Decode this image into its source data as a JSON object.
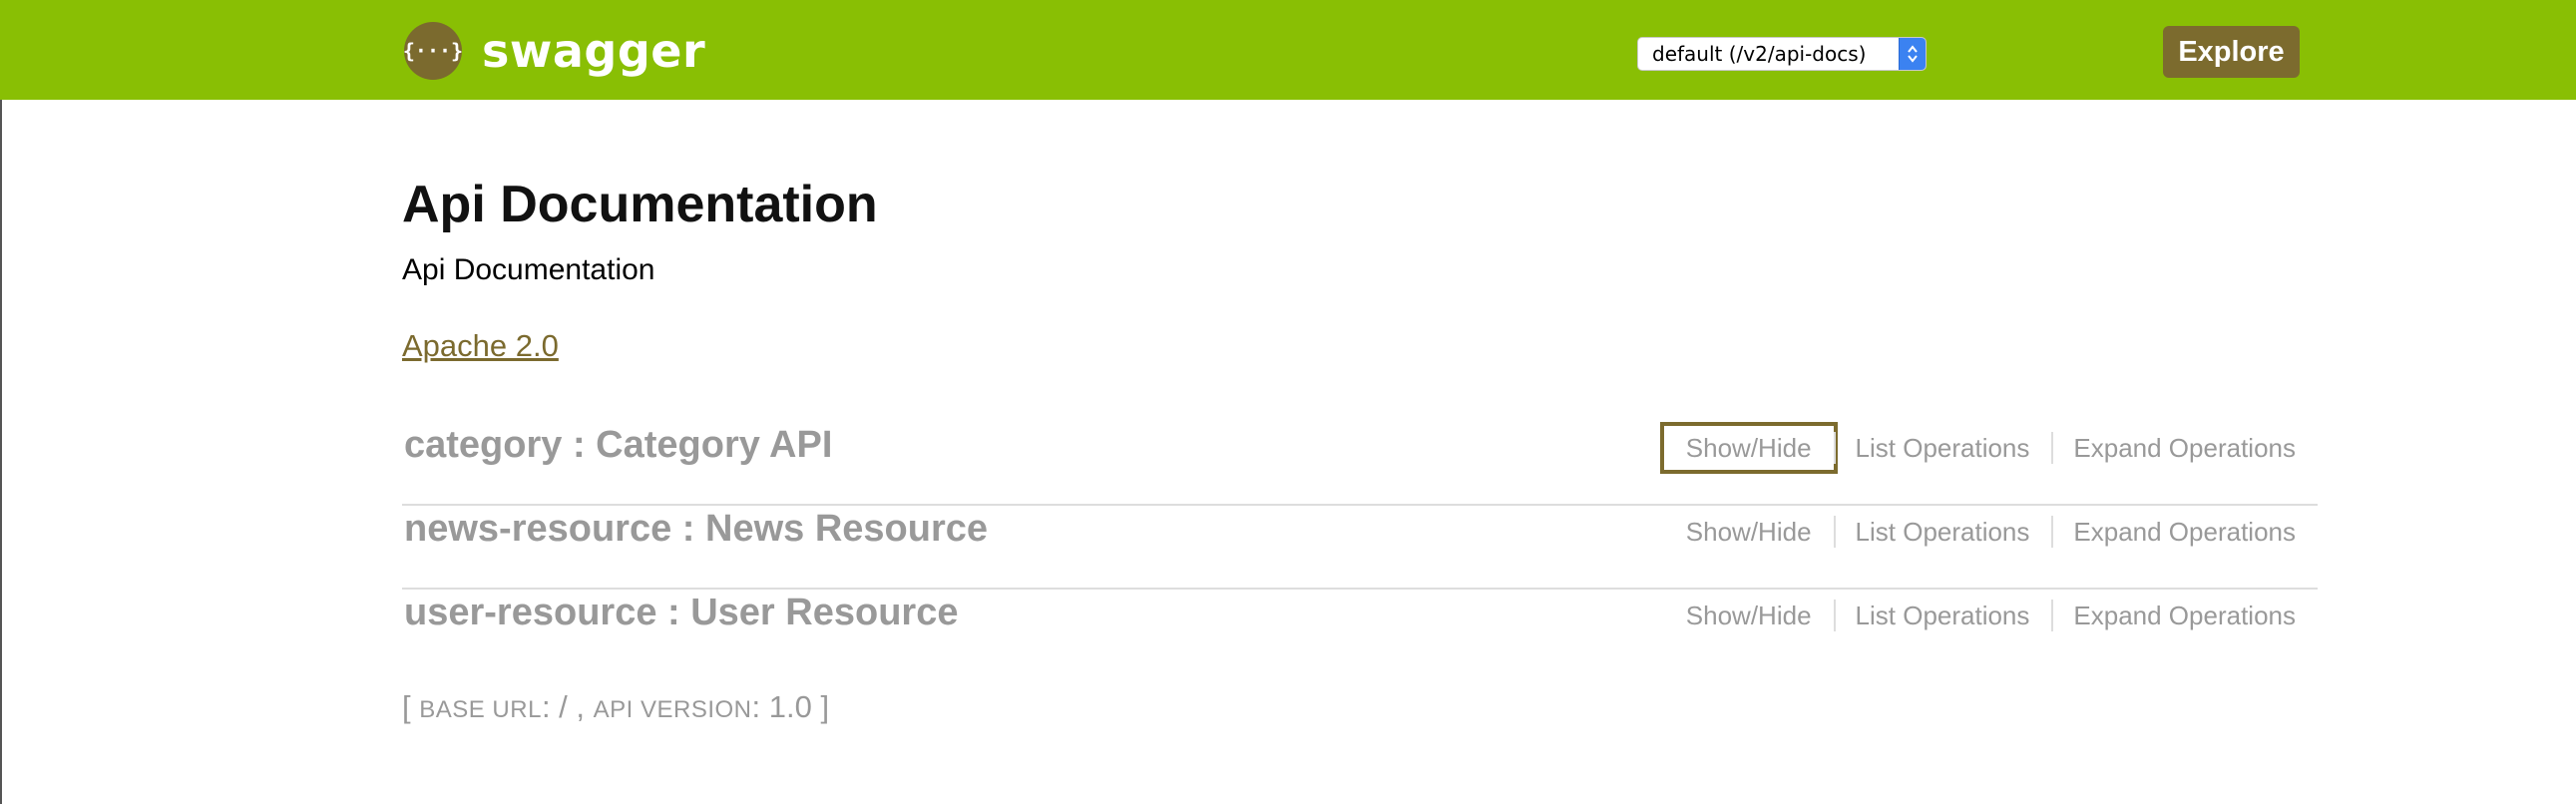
{
  "header": {
    "brand": "swagger",
    "logo_glyph": "{···}",
    "logo_icon": "swagger-logo-icon",
    "spec_selector": {
      "selected": "default (/v2/api-docs)"
    },
    "explore_label": "Explore",
    "colors": {
      "header_bg": "#89bf04",
      "accent": "#7c6b2e"
    }
  },
  "info": {
    "title": "Api Documentation",
    "description": "Api Documentation",
    "license_link": "Apache 2.0"
  },
  "resources": [
    {
      "name": "category : Category API",
      "show_hide": "Show/Hide",
      "list_ops": "List Operations",
      "expand_ops": "Expand Operations"
    },
    {
      "name": "news-resource : News Resource",
      "show_hide": "Show/Hide",
      "list_ops": "List Operations",
      "expand_ops": "Expand Operations"
    },
    {
      "name": "user-resource : User Resource",
      "show_hide": "Show/Hide",
      "list_ops": "List Operations",
      "expand_ops": "Expand Operations"
    }
  ],
  "footer": {
    "open": "[ ",
    "base_url_label": "base url",
    "base_url_value": ": / , ",
    "api_version_label": "api version",
    "api_version_value": ": 1.0",
    "close": " ]"
  }
}
